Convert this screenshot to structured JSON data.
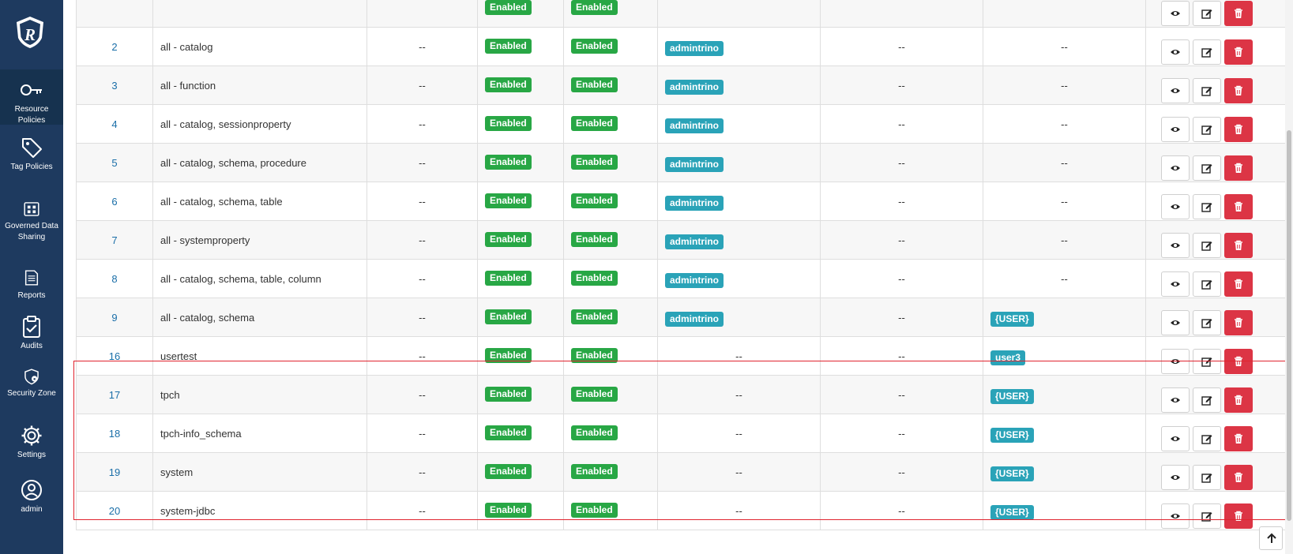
{
  "sidebar": {
    "items": [
      {
        "label": "Resource Policies",
        "icon": "key-icon"
      },
      {
        "label": "Tag Policies",
        "icon": "tag-icon"
      },
      {
        "label": "Governed Data Sharing",
        "icon": "grid-icon"
      },
      {
        "label": "Reports",
        "icon": "report-icon"
      },
      {
        "label": "Audits",
        "icon": "clipboard-check-icon"
      },
      {
        "label": "Security Zone",
        "icon": "shield-lock-icon"
      },
      {
        "label": "Settings",
        "icon": "gear-icon"
      },
      {
        "label": "admin",
        "icon": "user-circle-icon"
      }
    ]
  },
  "table": {
    "rows": [
      {
        "id": "",
        "name": "",
        "c3": "",
        "policy_status": "Enabled",
        "audit_logging": "Enabled",
        "roles": "",
        "groups": "",
        "users": "",
        "partial": true
      },
      {
        "id": "2",
        "name": "all - catalog",
        "c3": "--",
        "policy_status": "Enabled",
        "audit_logging": "Enabled",
        "roles": "admintrino",
        "groups": "--",
        "users": "--"
      },
      {
        "id": "3",
        "name": "all - function",
        "c3": "--",
        "policy_status": "Enabled",
        "audit_logging": "Enabled",
        "roles": "admintrino",
        "groups": "--",
        "users": "--"
      },
      {
        "id": "4",
        "name": "all - catalog, sessionproperty",
        "c3": "--",
        "policy_status": "Enabled",
        "audit_logging": "Enabled",
        "roles": "admintrino",
        "groups": "--",
        "users": "--"
      },
      {
        "id": "5",
        "name": "all - catalog, schema, procedure",
        "c3": "--",
        "policy_status": "Enabled",
        "audit_logging": "Enabled",
        "roles": "admintrino",
        "groups": "--",
        "users": "--"
      },
      {
        "id": "6",
        "name": "all - catalog, schema, table",
        "c3": "--",
        "policy_status": "Enabled",
        "audit_logging": "Enabled",
        "roles": "admintrino",
        "groups": "--",
        "users": "--"
      },
      {
        "id": "7",
        "name": "all - systemproperty",
        "c3": "--",
        "policy_status": "Enabled",
        "audit_logging": "Enabled",
        "roles": "admintrino",
        "groups": "--",
        "users": "--"
      },
      {
        "id": "8",
        "name": "all - catalog, schema, table, column",
        "c3": "--",
        "policy_status": "Enabled",
        "audit_logging": "Enabled",
        "roles": "admintrino",
        "groups": "--",
        "users": "--"
      },
      {
        "id": "9",
        "name": "all - catalog, schema",
        "c3": "--",
        "policy_status": "Enabled",
        "audit_logging": "Enabled",
        "roles": "admintrino",
        "groups": "--",
        "users": "{USER}"
      },
      {
        "id": "16",
        "name": "usertest",
        "c3": "--",
        "policy_status": "Enabled",
        "audit_logging": "Enabled",
        "roles": "--",
        "groups": "--",
        "users": "user3"
      },
      {
        "id": "17",
        "name": "tpch",
        "c3": "--",
        "policy_status": "Enabled",
        "audit_logging": "Enabled",
        "roles": "--",
        "groups": "--",
        "users": "{USER}"
      },
      {
        "id": "18",
        "name": "tpch-info_schema",
        "c3": "--",
        "policy_status": "Enabled",
        "audit_logging": "Enabled",
        "roles": "--",
        "groups": "--",
        "users": "{USER}"
      },
      {
        "id": "19",
        "name": "system",
        "c3": "--",
        "policy_status": "Enabled",
        "audit_logging": "Enabled",
        "roles": "--",
        "groups": "--",
        "users": "{USER}"
      },
      {
        "id": "20",
        "name": "system-jdbc",
        "c3": "--",
        "policy_status": "Enabled",
        "audit_logging": "Enabled",
        "roles": "--",
        "groups": "--",
        "users": "{USER}"
      }
    ]
  },
  "colors": {
    "sidebar_bg": "#1e3a5f",
    "enabled_badge": "#28a745",
    "principal_badge": "#2aa3b8",
    "delete_button": "#dc3545",
    "highlight_border": "#e0242f",
    "id_link": "#1a6ea8"
  }
}
